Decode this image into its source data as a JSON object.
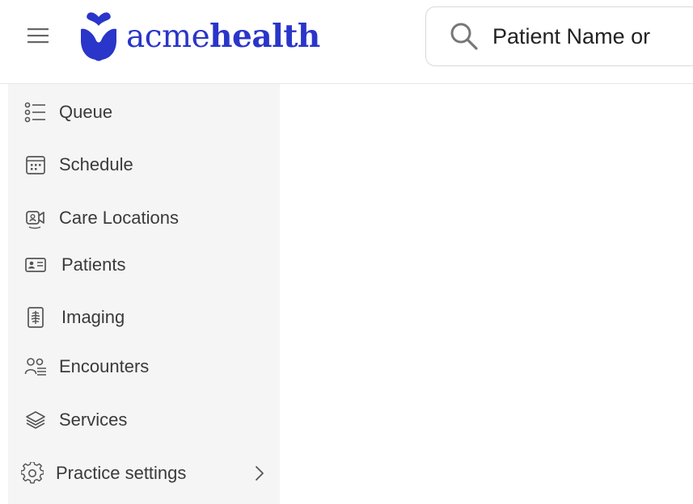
{
  "brand": {
    "name_light": "acme",
    "name_bold": "health",
    "color": "#2a35c9"
  },
  "search": {
    "placeholder": "Patient Name or",
    "icon": "search-icon"
  },
  "sidebar": {
    "items": [
      {
        "label": "Queue",
        "icon": "list-icon"
      },
      {
        "label": "Schedule",
        "icon": "calendar-icon"
      },
      {
        "label": "Care Locations",
        "icon": "video-call-icon"
      },
      {
        "label": "Patients",
        "icon": "id-card-icon"
      },
      {
        "label": "Imaging",
        "icon": "xray-icon"
      },
      {
        "label": "Encounters",
        "icon": "people-list-icon"
      },
      {
        "label": "Services",
        "icon": "layers-icon"
      },
      {
        "label": "Practice settings",
        "icon": "gear-icon",
        "expandable": true
      }
    ]
  }
}
